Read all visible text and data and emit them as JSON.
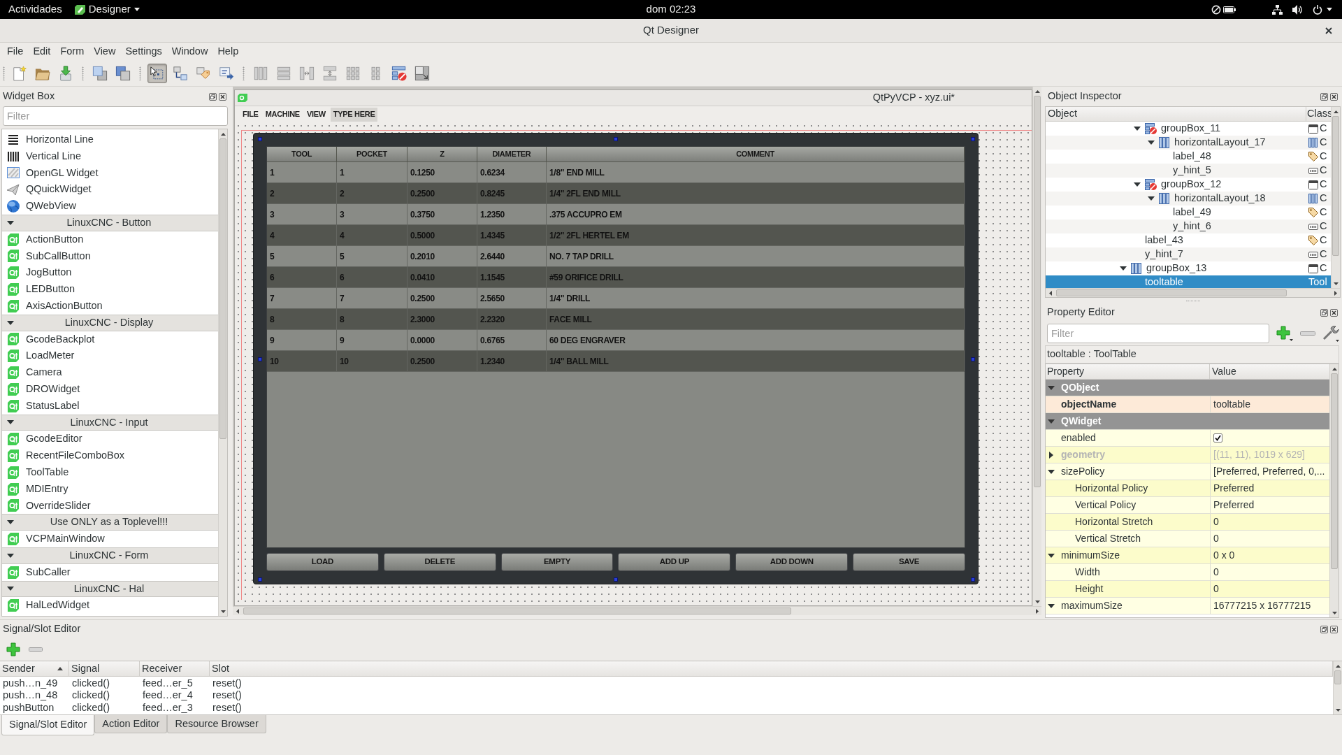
{
  "top_bar": {
    "activities": "Actividades",
    "app_menu": "Designer",
    "clock": "dom 02:23"
  },
  "window": {
    "title": "Qt Designer"
  },
  "menu_bar": [
    "File",
    "Edit",
    "Form",
    "View",
    "Settings",
    "Window",
    "Help"
  ],
  "toolbar": [
    [
      {
        "kind": "new"
      },
      {
        "kind": "open"
      },
      {
        "kind": "save"
      }
    ],
    [
      {
        "kind": "send_back"
      },
      {
        "kind": "bring_front"
      }
    ],
    [
      {
        "kind": "edit_widgets",
        "selected": true
      },
      {
        "kind": "edit_signals",
        "selected": false
      },
      {
        "kind": "edit_buddies",
        "selected": false
      },
      {
        "kind": "edit_tab_order",
        "selected": false
      }
    ],
    [
      {
        "kind": "layout_h"
      },
      {
        "kind": "layout_v"
      },
      {
        "kind": "split_h"
      },
      {
        "kind": "split_v"
      },
      {
        "kind": "grid"
      },
      {
        "kind": "form"
      },
      {
        "kind": "break_layout"
      },
      {
        "kind": "adjust_size"
      }
    ]
  ],
  "widget_box": {
    "title": "Widget Box",
    "filter": {
      "placeholder": "Filter"
    },
    "sections": [
      {
        "expanded": true,
        "items": [
          {
            "label": "Horizontal Line",
            "kind": "hline"
          },
          {
            "label": "Vertical Line",
            "kind": "vline"
          },
          {
            "label": "OpenGL Widget",
            "kind": "opengl"
          },
          {
            "label": "QQuickWidget",
            "kind": "quick"
          },
          {
            "label": "QWebView",
            "kind": "web"
          }
        ]
      },
      {
        "title": "LinuxCNC - Button",
        "expanded": true,
        "items": [
          {
            "label": "ActionButton",
            "kind": "qt"
          },
          {
            "label": "SubCallButton",
            "kind": "qt"
          },
          {
            "label": "JogButton",
            "kind": "qt"
          },
          {
            "label": "LEDButton",
            "kind": "qt"
          },
          {
            "label": "AxisActionButton",
            "kind": "qt"
          }
        ]
      },
      {
        "title": "LinuxCNC - Display",
        "expanded": true,
        "items": [
          {
            "label": "GcodeBackplot",
            "kind": "qt"
          },
          {
            "label": "LoadMeter",
            "kind": "qt"
          },
          {
            "label": "Camera",
            "kind": "qt"
          },
          {
            "label": "DROWidget",
            "kind": "qt"
          },
          {
            "label": "StatusLabel",
            "kind": "qt"
          }
        ]
      },
      {
        "title": "LinuxCNC - Input",
        "expanded": true,
        "items": [
          {
            "label": "GcodeEditor",
            "kind": "qt"
          },
          {
            "label": "RecentFileComboBox",
            "kind": "qt"
          },
          {
            "label": "ToolTable",
            "kind": "qt"
          },
          {
            "label": "MDIEntry",
            "kind": "qt"
          },
          {
            "label": "OverrideSlider",
            "kind": "qt"
          }
        ]
      },
      {
        "title": "Use ONLY as a Toplevel!!!",
        "expanded": true,
        "items": [
          {
            "label": "VCPMainWindow",
            "kind": "qt"
          }
        ]
      },
      {
        "title": "LinuxCNC - Form",
        "expanded": true,
        "items": [
          {
            "label": "SubCaller",
            "kind": "qt"
          }
        ]
      },
      {
        "title": "LinuxCNC - Hal",
        "expanded": true,
        "items": [
          {
            "label": "HalLedWidget",
            "kind": "qt"
          }
        ]
      }
    ]
  },
  "form_window": {
    "title": "QtPyVCP - xyz.ui*",
    "menu": [
      {
        "label": "FILE",
        "kind": "menu"
      },
      {
        "label": "MACHINE",
        "kind": "menu"
      },
      {
        "label": "VIEW",
        "kind": "menu"
      },
      {
        "label": "TYPE HERE",
        "kind": "placeholder"
      }
    ],
    "tool_table": {
      "selected": true,
      "columns": [
        "TOOL",
        "POCKET",
        "Z",
        "DIAMETER",
        "COMMENT"
      ],
      "rows": [
        [
          "1",
          "1",
          "0.1250",
          "0.6234",
          "1/8\" END MILL"
        ],
        [
          "2",
          "2",
          "0.2500",
          "0.8245",
          "1/4\" 2FL END MILL"
        ],
        [
          "3",
          "3",
          "0.3750",
          "1.2350",
          ".375 ACCUPRO EM"
        ],
        [
          "4",
          "4",
          "0.5000",
          "1.4345",
          "1/2\" 2FL HERTEL EM"
        ],
        [
          "5",
          "5",
          "0.2010",
          "2.6440",
          "NO. 7 TAP DRILL"
        ],
        [
          "6",
          "6",
          "0.0410",
          "1.1545",
          "#59 ORIFICE DRILL"
        ],
        [
          "7",
          "7",
          "0.2500",
          "2.5650",
          "1/4\" DRILL"
        ],
        [
          "8",
          "8",
          "2.3000",
          "2.2320",
          "FACE MILL"
        ],
        [
          "9",
          "9",
          "0.0000",
          "0.6765",
          "60 DEG ENGRAVER"
        ],
        [
          "10",
          "10",
          "0.2500",
          "1.2340",
          "1/4\" BALL MILL"
        ]
      ],
      "buttons": [
        "LOAD",
        "DELETE",
        "EMPTY",
        "ADD UP",
        "ADD DOWN",
        "SAVE"
      ]
    }
  },
  "object_inspector": {
    "title": "Object Inspector",
    "columns": [
      "Object",
      "Class"
    ],
    "tree": [
      {
        "children": [
          {
            "name": "groupBox_11",
            "kind": "groupbox_nolayout",
            "class": "C",
            "expanded": true,
            "selected": false,
            "children": [
              {
                "name": "horizontalLayout_17",
                "kind": "hlayout",
                "class": "C",
                "expanded": true,
                "selected": false,
                "children": [
                  {
                    "name": "label_48",
                    "kind": "label",
                    "class": "C",
                    "selected": false
                  },
                  {
                    "name": "y_hint_5",
                    "kind": "lineedit",
                    "class": "C",
                    "selected": false
                  }
                ]
              }
            ]
          },
          {
            "name": "groupBox_12",
            "kind": "groupbox_nolayout",
            "class": "C",
            "expanded": true,
            "selected": false,
            "children": [
              {
                "name": "horizontalLayout_18",
                "kind": "hlayout",
                "class": "C",
                "expanded": true,
                "selected": false,
                "children": [
                  {
                    "name": "label_49",
                    "kind": "label",
                    "class": "C",
                    "selected": false
                  },
                  {
                    "name": "y_hint_6",
                    "kind": "lineedit",
                    "class": "C",
                    "selected": false
                  }
                ]
              }
            ]
          },
          {
            "name": "label_43",
            "kind": "label",
            "class": "C",
            "selected": false
          },
          {
            "name": "y_hint_7",
            "kind": "lineedit",
            "class": "C",
            "selected": false
          }
        ]
      },
      {
        "name": "groupBox_13",
        "kind": "groupbox_hlayout",
        "class": "C",
        "expanded": true,
        "selected": false,
        "children": [
          {
            "name": "tooltable",
            "kind": "custom",
            "class": "Tool",
            "selected": true
          }
        ]
      }
    ]
  },
  "property_editor": {
    "title": "Property Editor",
    "filter": {
      "placeholder": "Filter"
    },
    "object_label": "tooltable : ToolTable",
    "columns": [
      "Property",
      "Value"
    ],
    "groups": [
      {
        "name": "QObject",
        "expanded": true,
        "properties": [
          {
            "name": "objectName",
            "kind": "text",
            "value": "tooltable",
            "modified": true,
            "disabled": false
          }
        ]
      },
      {
        "name": "QWidget",
        "expanded": true,
        "properties": [
          {
            "name": "enabled",
            "kind": "checkbox",
            "checked": true,
            "modified": false,
            "disabled": false
          },
          {
            "name": "geometry",
            "kind": "text",
            "value": "[(11, 11), 1019 x 629]",
            "expanded": false,
            "modified": true,
            "disabled": true
          },
          {
            "name": "sizePolicy",
            "kind": "text",
            "value": "[Preferred, Preferred, 0,...",
            "expanded": true,
            "modified": false,
            "disabled": false,
            "children": [
              {
                "name": "Horizontal Policy",
                "kind": "text",
                "value": "Preferred",
                "modified": false,
                "disabled": false
              },
              {
                "name": "Vertical Policy",
                "kind": "text",
                "value": "Preferred",
                "modified": false,
                "disabled": false
              },
              {
                "name": "Horizontal Stretch",
                "kind": "text",
                "value": "0",
                "modified": false,
                "disabled": false
              },
              {
                "name": "Vertical Stretch",
                "kind": "text",
                "value": "0",
                "modified": false,
                "disabled": false
              }
            ]
          },
          {
            "name": "minimumSize",
            "kind": "text",
            "value": "0 x 0",
            "expanded": true,
            "modified": false,
            "disabled": false,
            "children": [
              {
                "name": "Width",
                "kind": "text",
                "value": "0",
                "modified": false,
                "disabled": false
              },
              {
                "name": "Height",
                "kind": "text",
                "value": "0",
                "modified": false,
                "disabled": false
              }
            ]
          },
          {
            "name": "maximumSize",
            "kind": "text",
            "value": "16777215 x 16777215",
            "expanded": true,
            "modified": false,
            "disabled": false
          }
        ]
      }
    ]
  },
  "signal_slot_editor": {
    "title": "Signal/Slot Editor",
    "columns": [
      {
        "label": "Sender",
        "sorted": true
      },
      {
        "label": "Signal",
        "sorted": false
      },
      {
        "label": "Receiver",
        "sorted": false
      },
      {
        "label": "Slot",
        "sorted": false
      }
    ],
    "rows": [
      [
        "push…n_49",
        "clicked()",
        "feed…er_5",
        "reset()"
      ],
      [
        "push…n_48",
        "clicked()",
        "feed…er_4",
        "reset()"
      ],
      [
        "pushButton",
        "clicked()",
        "feed…er_3",
        "reset()"
      ]
    ]
  },
  "bottom_tabs": [
    {
      "label": "Signal/Slot Editor",
      "selected": true
    },
    {
      "label": "Action Editor",
      "selected": false
    },
    {
      "label": "Resource Browser",
      "selected": false
    }
  ]
}
